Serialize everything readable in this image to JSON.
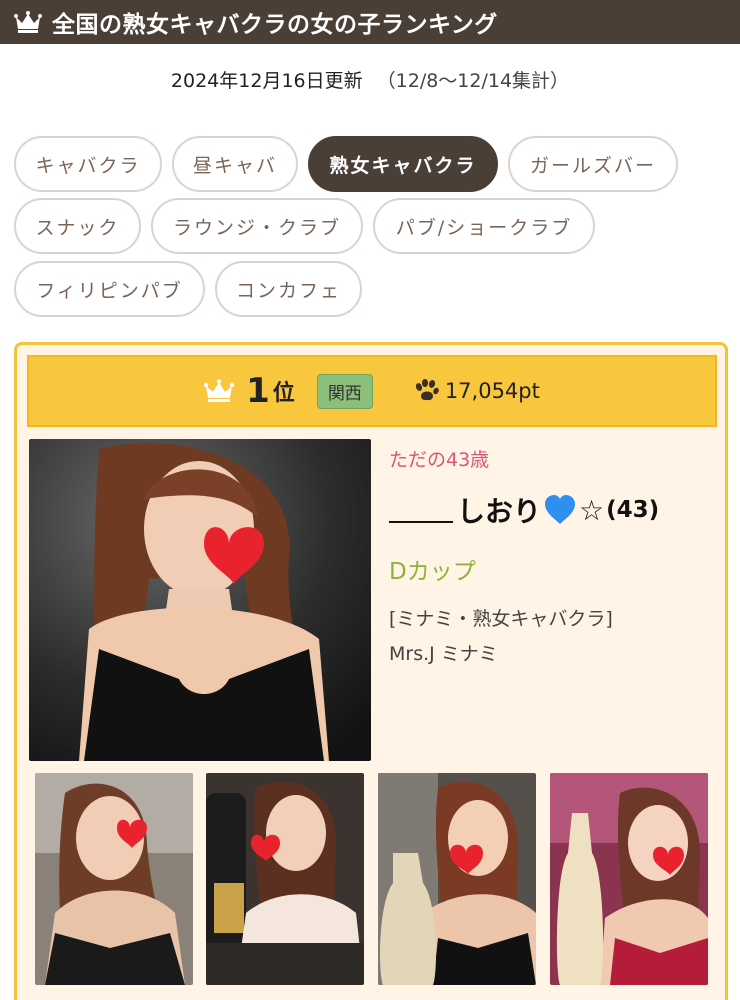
{
  "header": {
    "title": "全国の熟女キャバクラの女の子ランキング",
    "icon": "crown-icon"
  },
  "updated": {
    "date": "2024年12月16日更新",
    "range": "（12/8〜12/14集計）"
  },
  "tabs": [
    {
      "label": "キャバクラ",
      "active": false
    },
    {
      "label": "昼キャバ",
      "active": false
    },
    {
      "label": "熟女キャバクラ",
      "active": true
    },
    {
      "label": "ガールズバー",
      "active": false
    },
    {
      "label": "スナック",
      "active": false
    },
    {
      "label": "ラウンジ・クラブ",
      "active": false
    },
    {
      "label": "パブ/ショークラブ",
      "active": false
    },
    {
      "label": "フィリピンパブ",
      "active": false
    },
    {
      "label": "コンカフェ",
      "active": false
    }
  ],
  "ranking": {
    "rank": "1",
    "rank_suffix": "位",
    "region": "関西",
    "points": "17,054pt",
    "catch_copy": "ただの43歳",
    "name": "しおり",
    "name_suffix": "☆",
    "age": "(43)",
    "cup": "Dカップ",
    "shop_category": "[ミナミ・熟女キャバクラ]",
    "shop_name": "Mrs.J ミナミ"
  },
  "colors": {
    "header_bg": "#4a3f37",
    "active_tab_bg": "#4a3f37",
    "tab_text": "#7a6458",
    "rank_bar": "#f8c73d",
    "card_bg": "#fff4e6",
    "catch": "#d8567a",
    "cup": "#8db33a",
    "region_badge": "#8bbf7a"
  }
}
